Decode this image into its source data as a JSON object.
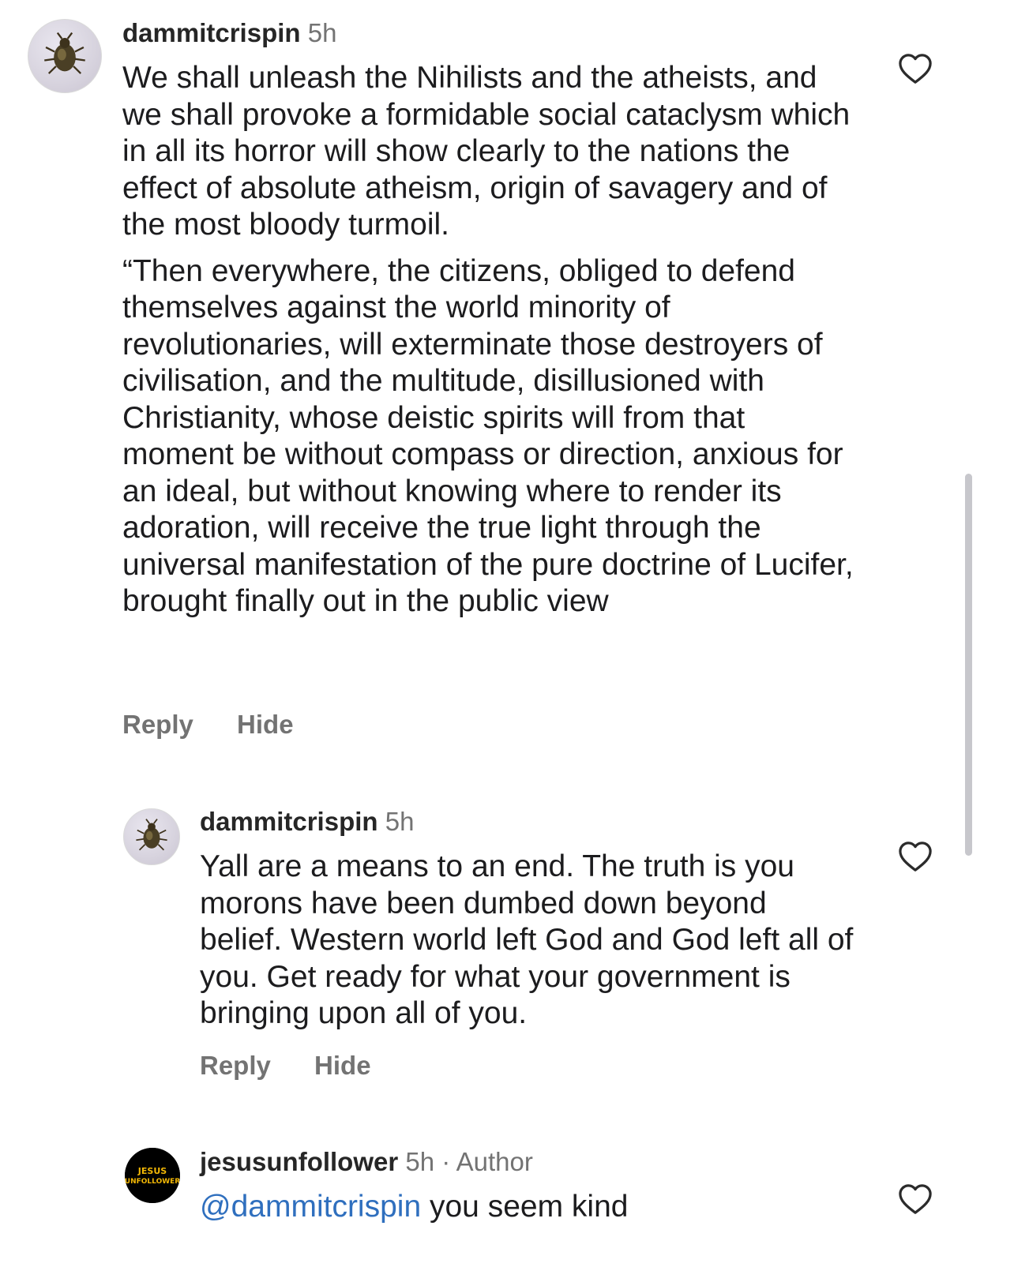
{
  "comments": [
    {
      "username": "dammitcrispin",
      "time": "5h",
      "paragraphs": [
        "We shall unleash the Nihilists and the atheists, and we shall provoke a formidable social cataclysm which in all its horror will show clearly to the nations the effect of absolute atheism, origin of savagery and of the most bloody turmoil.",
        "“Then everywhere, the citizens, obliged to defend themselves against the world minority of revolutionaries, will exterminate those destroyers of civilisation, and the multitude, disillusioned with Christianity, whose deistic spirits will from that moment be without compass or direction, anxious for an ideal, but without knowing where to render its adoration, will receive the true light through the universal manifestation of the pure doctrine of Lucifer, brought finally out in the public view"
      ],
      "reply_label": "Reply",
      "hide_label": "Hide",
      "avatar_icon": "beetle-avatar"
    },
    {
      "username": "dammitcrispin",
      "time": "5h",
      "paragraphs": [
        "Yall are a means to an end. The truth is you morons have been dumbed down beyond belief. Western world left God and God left all of you. Get ready for what your government is bringing upon all of you."
      ],
      "reply_label": "Reply",
      "hide_label": "Hide",
      "avatar_icon": "beetle-avatar"
    },
    {
      "username": "jesusunfollower",
      "time": "5h",
      "separator": "·",
      "author_tag": "Author",
      "mention": "@dammitcrispin",
      "text": " you seem kind",
      "avatar_logo_line1": "JESUS",
      "avatar_logo_line2": "UNFOLLOWER"
    }
  ],
  "colors": {
    "text": "#1c1c1e",
    "muted": "#737373",
    "mention": "#2f6fbe",
    "logo_yellow": "#f2b705",
    "logo_red": "#e0312b"
  }
}
